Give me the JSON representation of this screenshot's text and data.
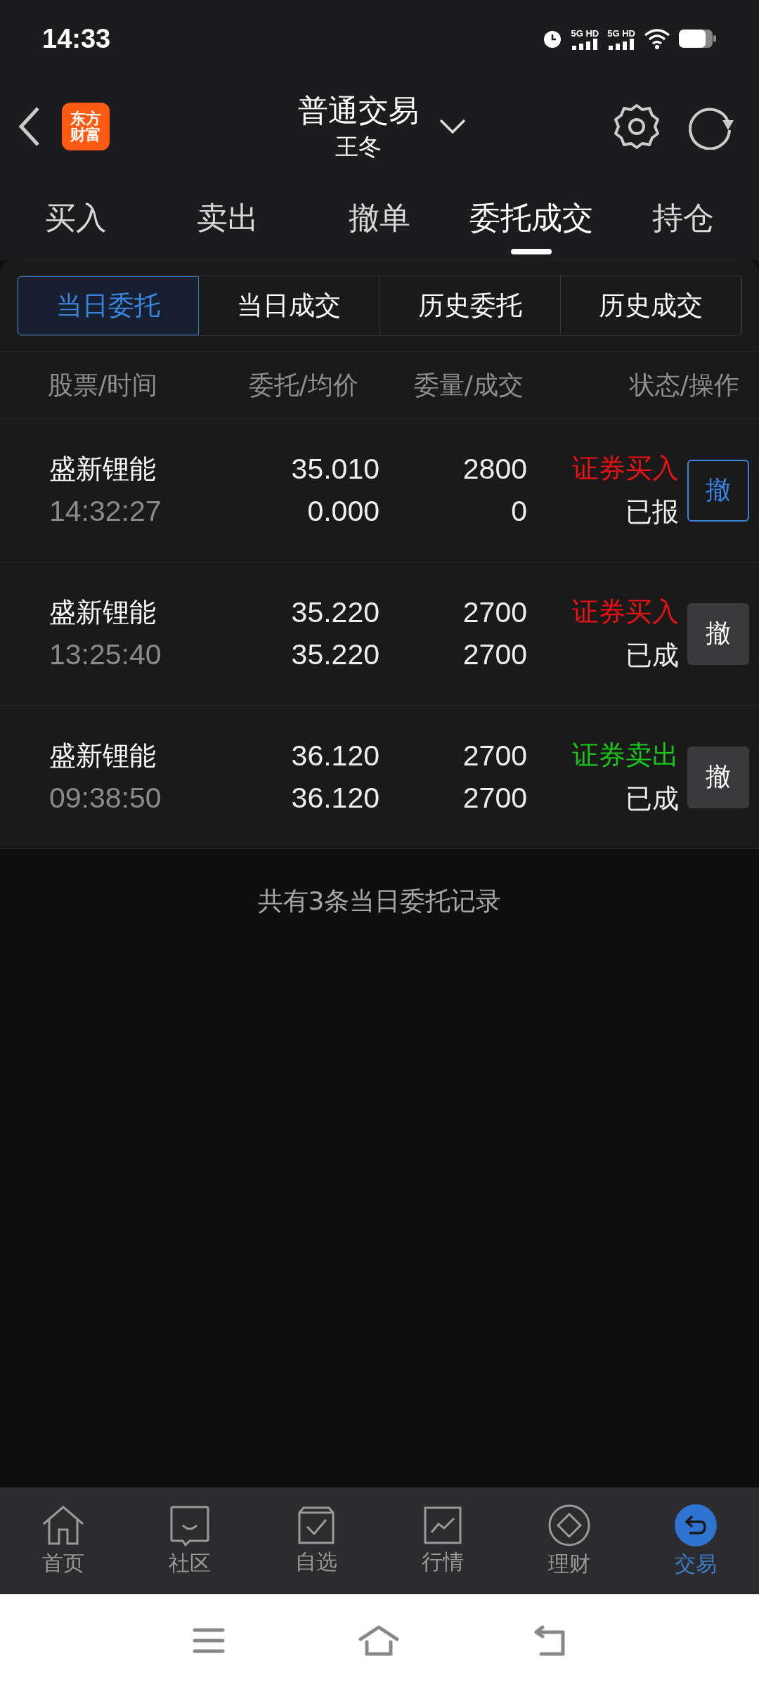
{
  "status_bar": {
    "time": "14:33",
    "sim_labels": [
      "5G HD",
      "5G HD"
    ]
  },
  "header": {
    "logo_lines": [
      "东方",
      "财富"
    ],
    "title": "普通交易",
    "subtitle": "王冬"
  },
  "tabs": [
    {
      "label": "买入",
      "selected": false
    },
    {
      "label": "卖出",
      "selected": false
    },
    {
      "label": "撤单",
      "selected": false
    },
    {
      "label": "委托成交",
      "selected": true
    },
    {
      "label": "持仓",
      "selected": false
    }
  ],
  "sub_tabs": [
    {
      "label": "当日委托",
      "selected": true
    },
    {
      "label": "当日成交",
      "selected": false
    },
    {
      "label": "历史委托",
      "selected": false
    },
    {
      "label": "历史成交",
      "selected": false
    }
  ],
  "table": {
    "columns": [
      "股票/时间",
      "委托/均价",
      "委量/成交",
      "状态/操作"
    ],
    "rows": [
      {
        "name": "盛新锂能",
        "time": "14:32:27",
        "price": "35.010",
        "avg_price": "0.000",
        "quantity": "2800",
        "filled": "0",
        "kind": "buy",
        "action": "证券买入",
        "status": "已报",
        "cancel": "撤",
        "cancelable": true
      },
      {
        "name": "盛新锂能",
        "time": "13:25:40",
        "price": "35.220",
        "avg_price": "35.220",
        "quantity": "2700",
        "filled": "2700",
        "kind": "buy",
        "action": "证券买入",
        "status": "已成",
        "cancel": "撤",
        "cancelable": false
      },
      {
        "name": "盛新锂能",
        "time": "09:38:50",
        "price": "36.120",
        "avg_price": "36.120",
        "quantity": "2700",
        "filled": "2700",
        "kind": "sell",
        "action": "证券卖出",
        "status": "已成",
        "cancel": "撤",
        "cancelable": false
      }
    ]
  },
  "summary": "共有3条当日委托记录",
  "bottom_nav": [
    {
      "label": "首页",
      "kind": "home",
      "selected": false
    },
    {
      "label": "社区",
      "kind": "chat",
      "selected": false
    },
    {
      "label": "自选",
      "kind": "check",
      "selected": false
    },
    {
      "label": "行情",
      "kind": "chart",
      "selected": false
    },
    {
      "label": "理财",
      "kind": "diamond",
      "selected": false
    },
    {
      "label": "交易",
      "kind": "trade",
      "selected": true
    }
  ]
}
